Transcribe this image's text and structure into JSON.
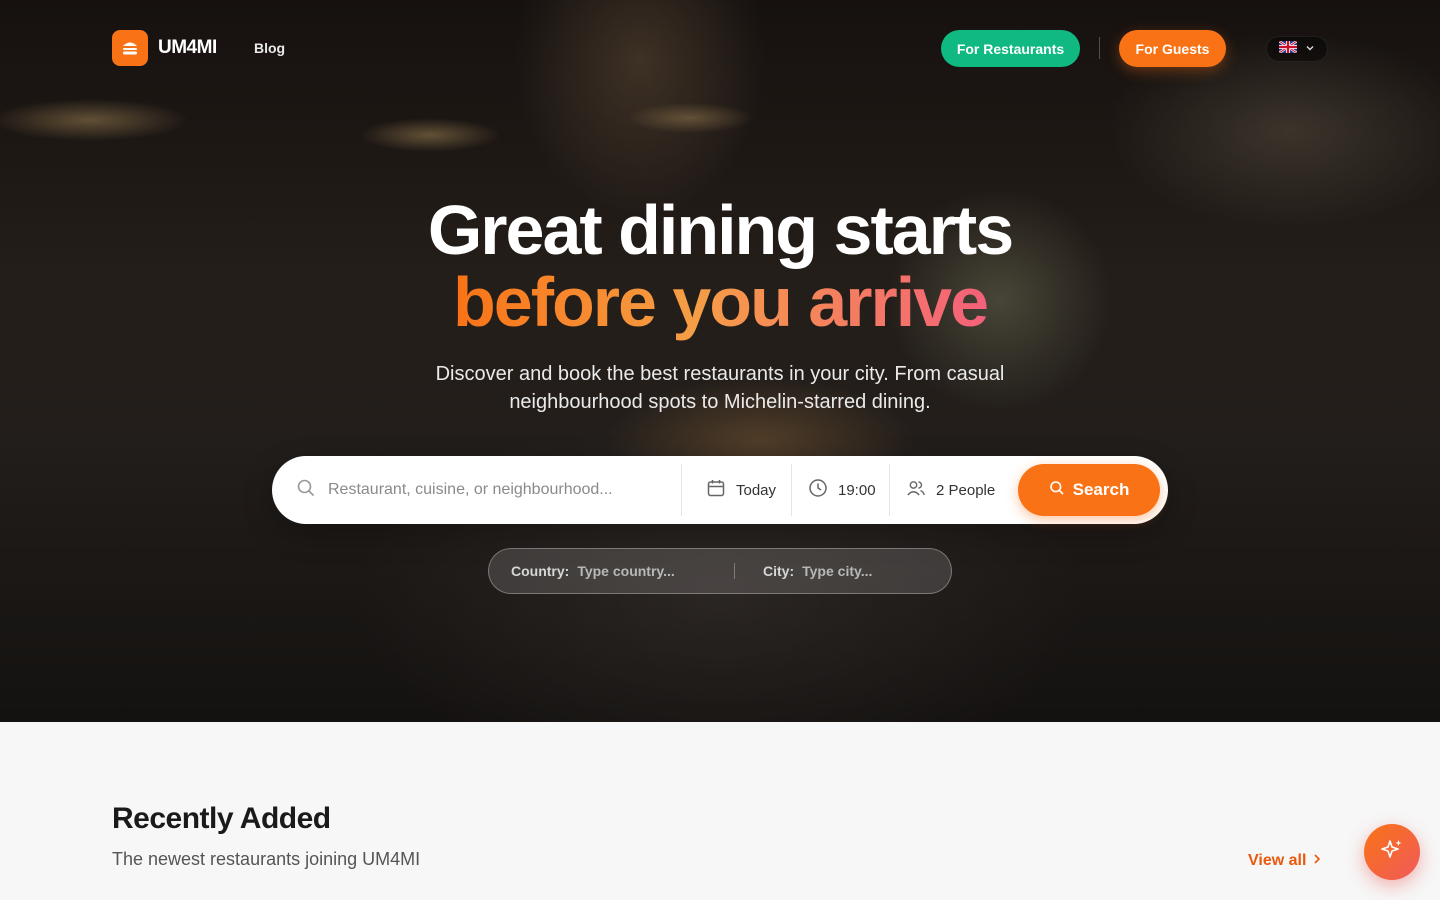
{
  "header": {
    "logo_text": "UM4MI",
    "nav_blog": "Blog",
    "for_restaurants": "For Restaurants",
    "for_guests": "For Guests",
    "language_icon": "uk-flag-icon"
  },
  "hero": {
    "title_line1": "Great dining starts",
    "title_line2": "before you arrive",
    "subtitle": "Discover and book the best restaurants in your city. From casual neighbourhood spots to Michelin-starred dining."
  },
  "search": {
    "placeholder": "Restaurant, cuisine, or neighbourhood...",
    "date": "Today",
    "time": "19:00",
    "people": "2 People",
    "button_label": "Search"
  },
  "location": {
    "country_label": "Country:",
    "country_placeholder": "Type country...",
    "city_label": "City:",
    "city_placeholder": "Type city..."
  },
  "recently_added": {
    "title": "Recently Added",
    "subtitle": "The newest restaurants joining UM4MI",
    "view_all": "View all"
  },
  "colors": {
    "brand_orange": "#f97316",
    "green": "#10b981"
  }
}
